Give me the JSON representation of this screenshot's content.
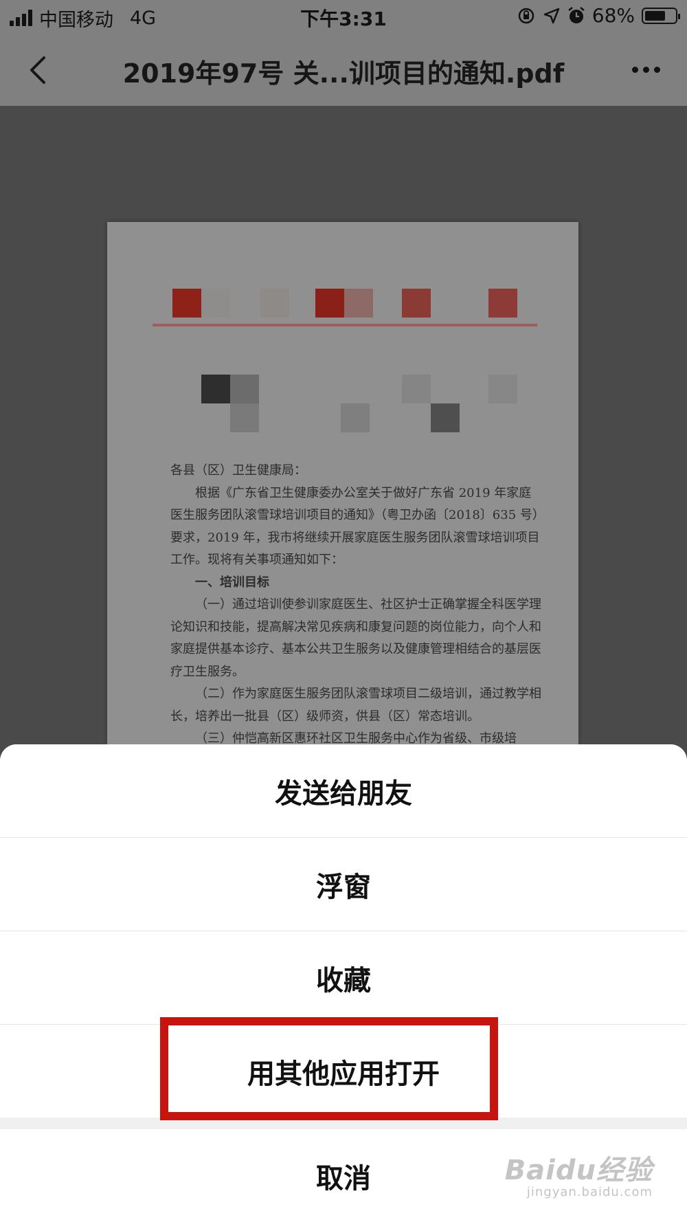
{
  "status_bar": {
    "carrier": "中国移动",
    "network": "4G",
    "time": "下午3:31",
    "battery_percent": "68%",
    "battery_level": 0.68
  },
  "nav": {
    "title": "2019年97号 关...训项目的通知.pdf",
    "back_icon": "chevron-left-icon",
    "more_icon": "more-dots-icon"
  },
  "document": {
    "paragraphs": [
      "各县（区）卫生健康局：",
      "根据《广东省卫生健康委办公室关于做好广东省 2019 年家庭医生服务团队滚雪球培训项目的通知》（粤卫办函〔2018〕635 号）要求，2019 年，我市将继续开展家庭医生服务团队滚雪球培训项目工作。现将有关事项通知如下：",
      "一、培训目标",
      "（一）通过培训使参训家庭医生、社区护士正确掌握全科医学理论知识和技能，提高解决常见疾病和康复问题的岗位能力，向个人和家庭提供基本诊疗、基本公共卫生服务以及健康管理相结合的基层医疗卫生服务。",
      "（二）作为家庭医生服务团队滚雪球项目二级培训，通过教学相长，培养出一批县（区）级师资，供县（区）常态培训。",
      "（三）仲恺高新区惠环社区卫生服务中心作为省级、市级培"
    ]
  },
  "action_sheet": {
    "items": [
      "发送给朋友",
      "浮窗",
      "收藏",
      "用其他应用打开"
    ],
    "cancel": "取消"
  },
  "watermark": {
    "brand": "Baidu经验",
    "url": "jingyan.baidu.com"
  },
  "colors": {
    "highlight": "#c8140e",
    "dim_bar": "#808080"
  }
}
